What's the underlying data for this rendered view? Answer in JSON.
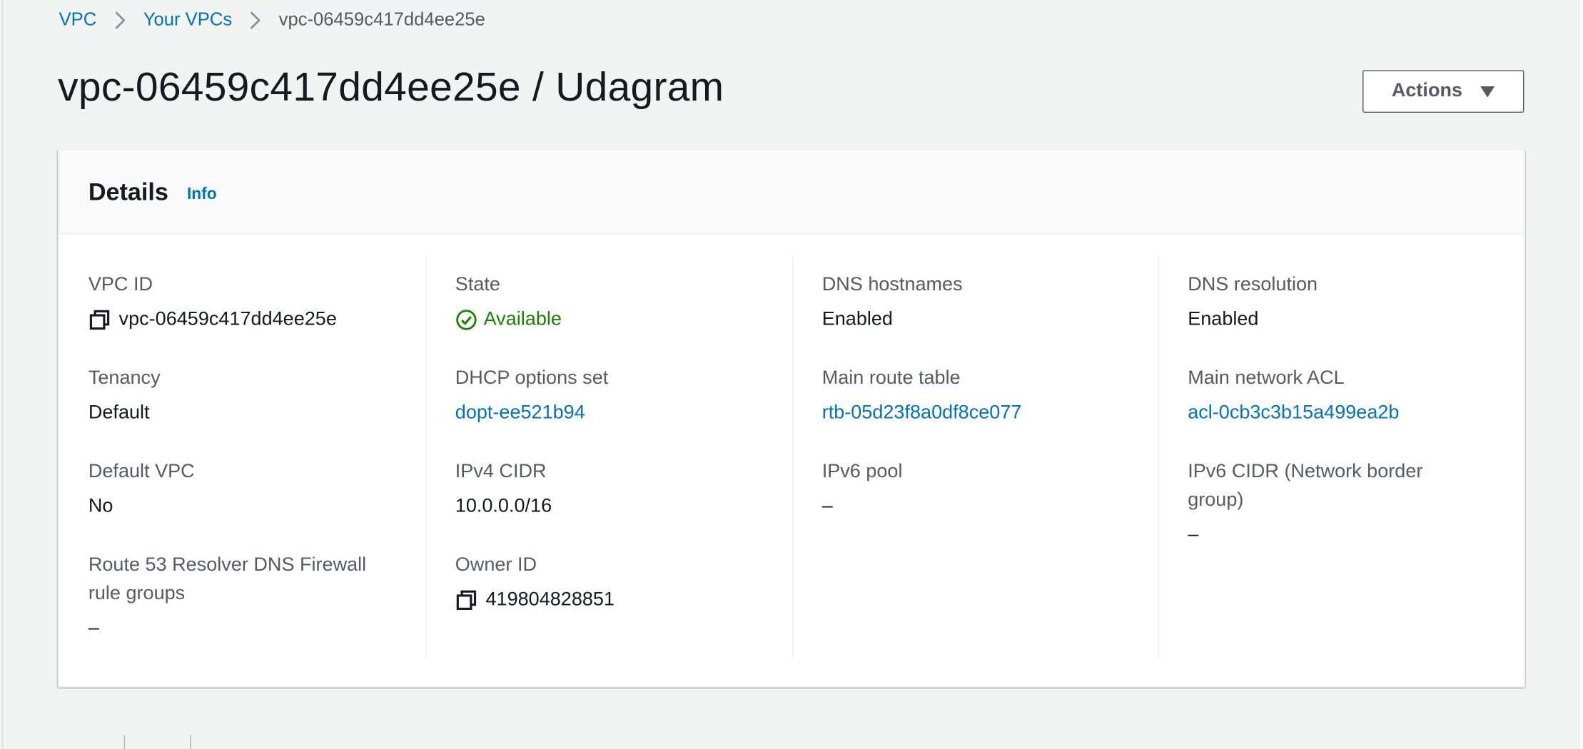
{
  "breadcrumb": {
    "items": [
      "VPC",
      "Your VPCs"
    ],
    "current": "vpc-06459c417dd4ee25e"
  },
  "page": {
    "title": "vpc-06459c417dd4ee25e / Udagram",
    "actions_label": "Actions"
  },
  "details": {
    "title": "Details",
    "info_label": "Info",
    "columns": [
      [
        {
          "label": "VPC ID",
          "value": "vpc-06459c417dd4ee25e",
          "icon": "copy-icon"
        },
        {
          "label": "Tenancy",
          "value": "Default"
        },
        {
          "label": "Default VPC",
          "value": "No"
        },
        {
          "label": "Route 53 Resolver DNS Firewall rule groups",
          "value": "–"
        }
      ],
      [
        {
          "label": "State",
          "value": "Available",
          "icon": "check-circle-icon"
        },
        {
          "label": "DHCP options set",
          "value": "dopt-ee521b94",
          "link": true
        },
        {
          "label": "IPv4 CIDR",
          "value": "10.0.0.0/16"
        },
        {
          "label": "Owner ID",
          "value": "419804828851",
          "icon": "copy-icon"
        }
      ],
      [
        {
          "label": "DNS hostnames",
          "value": "Enabled"
        },
        {
          "label": "Main route table",
          "value": "rtb-05d23f8a0df8ce077",
          "link": true
        },
        {
          "label": "IPv6 pool",
          "value": "–"
        }
      ],
      [
        {
          "label": "DNS resolution",
          "value": "Enabled"
        },
        {
          "label": "Main network ACL",
          "value": "acl-0cb3c3b15a499ea2b",
          "link": true
        },
        {
          "label": "IPv6 CIDR (Network border group)",
          "value": "–"
        }
      ]
    ]
  },
  "colors": {
    "link": "#0073bb",
    "success": "#1d8102",
    "active_tab": "#ec7211",
    "background": "#f2f3f3"
  }
}
